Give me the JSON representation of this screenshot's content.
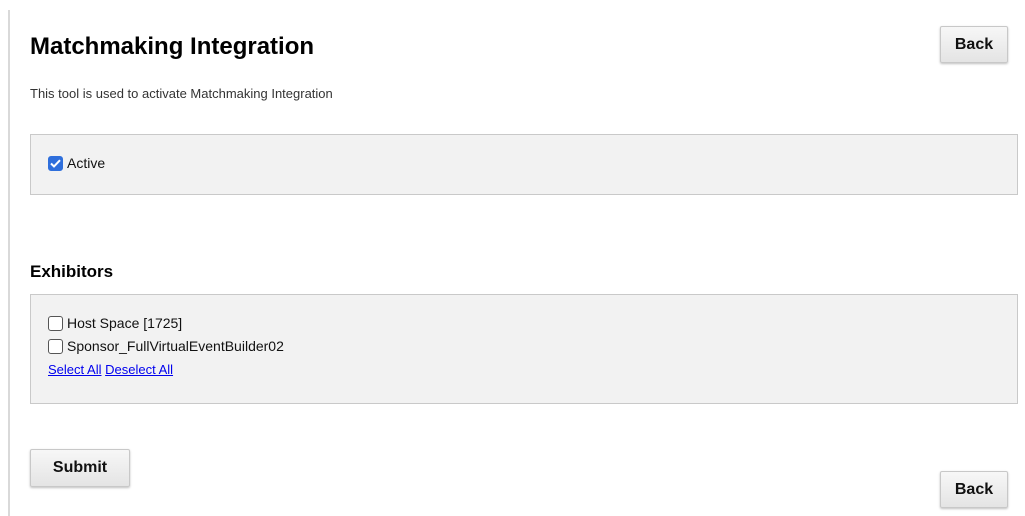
{
  "header": {
    "title": "Matchmaking Integration",
    "subtitle": "This tool is used to activate Matchmaking Integration",
    "back_label": "Back"
  },
  "active_panel": {
    "label": "Active",
    "checked": true
  },
  "exhibitors": {
    "heading": "Exhibitors",
    "items": [
      {
        "label": "Host Space [1725]",
        "checked": false
      },
      {
        "label": "Sponsor_FullVirtualEventBuilder02",
        "checked": false
      }
    ],
    "select_all_label": "Select All",
    "deselect_all_label": "Deselect All"
  },
  "footer": {
    "submit_label": "Submit",
    "back_label": "Back"
  },
  "colors": {
    "checkbox_checked": "#2f6fdc",
    "link": "#0000ee",
    "panel_bg": "#f2f2f2"
  }
}
